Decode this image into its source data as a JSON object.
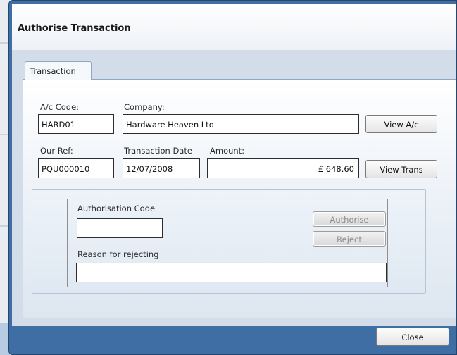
{
  "dialog": {
    "title": "Authorise Transaction"
  },
  "tabs": [
    {
      "label": "Transaction",
      "active": true
    }
  ],
  "transaction": {
    "ac_code_label": "A/c Code:",
    "ac_code_value": "HARD01",
    "company_label": "Company:",
    "company_value": "Hardware Heaven Ltd",
    "view_ac_label": "View A/c",
    "our_ref_label": "Our Ref:",
    "our_ref_value": "PQU000010",
    "trans_date_label": "Transaction Date",
    "trans_date_value": "12/07/2008",
    "amount_label": "Amount:",
    "amount_value": "£ 648.60",
    "view_trans_label": "View Trans"
  },
  "authorisation": {
    "code_label": "Authorisation Code",
    "code_value": "",
    "reason_label": "Reason for rejecting",
    "reason_value": "",
    "authorise_label": "Authorise",
    "reject_label": "Reject"
  },
  "footer": {
    "close_label": "Close"
  },
  "colors": {
    "frame": "#3f6ea5",
    "panel_bg": "#d3dde9",
    "disabled_text": "#8c8c8c"
  }
}
